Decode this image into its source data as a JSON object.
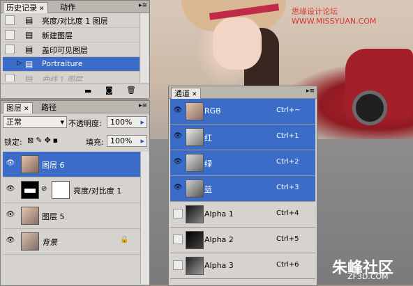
{
  "watermark": {
    "site": "思缘设计论坛 WWW.MISSYUAN.COM",
    "brand": "朱峰社区",
    "brand_sub": "ZF3D.COM"
  },
  "history_panel": {
    "tabs": [
      "历史记录",
      "动作"
    ],
    "items": [
      {
        "label": "亮度/对比度 1 图层",
        "selected": false
      },
      {
        "label": "新建图层",
        "selected": false
      },
      {
        "label": "盖印可见图层",
        "selected": false
      },
      {
        "label": "Portraiture",
        "selected": true
      },
      {
        "label": "曲线 1 图层",
        "selected": false,
        "dimmed": true
      }
    ]
  },
  "layers_panel": {
    "tabs": [
      "图层",
      "路径"
    ],
    "blend_mode": "正常",
    "opacity_label": "不透明度:",
    "opacity_value": "100%",
    "lock_label": "锁定:",
    "fill_label": "填充:",
    "fill_value": "100%",
    "layers": [
      {
        "name": "图层 6",
        "selected": true
      },
      {
        "name": "亮度/对比度 1",
        "selected": false
      },
      {
        "name": "图层 5",
        "selected": false
      },
      {
        "name": "背景",
        "selected": false,
        "italic": true
      }
    ]
  },
  "channels_panel": {
    "tabs": [
      "通道"
    ],
    "channels": [
      {
        "name": "RGB",
        "shortcut": "Ctrl+~",
        "selected": true,
        "visible": true
      },
      {
        "name": "红",
        "shortcut": "Ctrl+1",
        "selected": true,
        "visible": true
      },
      {
        "name": "绿",
        "shortcut": "Ctrl+2",
        "selected": true,
        "visible": true
      },
      {
        "name": "蓝",
        "shortcut": "Ctrl+3",
        "selected": true,
        "visible": true
      },
      {
        "name": "Alpha 1",
        "shortcut": "Ctrl+4",
        "selected": false,
        "visible": false
      },
      {
        "name": "Alpha 2",
        "shortcut": "Ctrl+5",
        "selected": false,
        "visible": false
      },
      {
        "name": "Alpha 3",
        "shortcut": "Ctrl+6",
        "selected": false,
        "visible": false
      }
    ]
  },
  "colors": {
    "selection": "#3a6cc8",
    "panel": "#d6d3ce"
  }
}
